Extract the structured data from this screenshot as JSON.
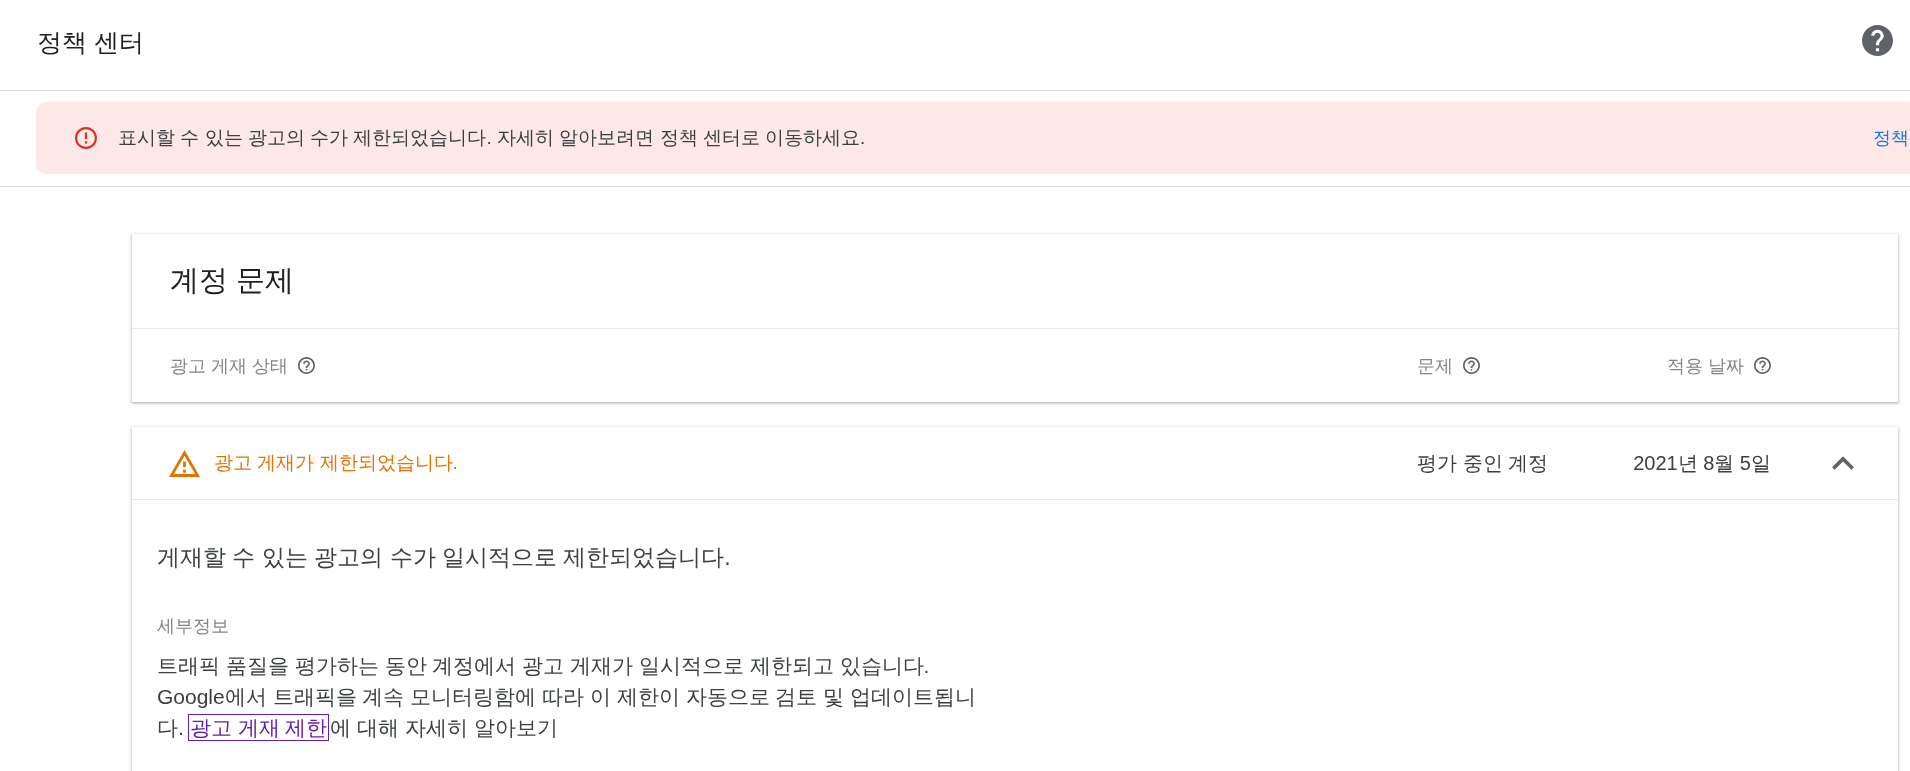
{
  "header": {
    "title": "정책 센터"
  },
  "alert": {
    "message": "표시할 수 있는 광고의 수가 제한되었습니다. 자세히 알아보려면 정책 센터로 이동하세요.",
    "link": "정책"
  },
  "account_issues": {
    "title": "계정 문제",
    "columns": [
      {
        "label": "광고 게재 상태"
      },
      {
        "label": "문제"
      },
      {
        "label": "적용 날짜"
      }
    ],
    "rows": [
      {
        "status": "광고 게재가 제한되었습니다.",
        "issue": "평가 중인 계정",
        "date": "2021년 8월 5일",
        "expanded": true,
        "details": {
          "headline": "게재할 수 있는 광고의 수가 일시적으로 제한되었습니다.",
          "label": "세부정보",
          "text_before": "트래픽 품질을 평가하는 동안 계정에서 광고 게재가 일시적으로 제한되고 있습니다. Google에서 트래픽을 계속 모니터링함에 따라 이 제한이 자동으로 검토 및 업데이트됩니다. ",
          "link": {
            "label": "광고 게재 제한",
            "focused": true
          },
          "text_after": "에 대해 자세히 알아보기"
        }
      }
    ]
  }
}
